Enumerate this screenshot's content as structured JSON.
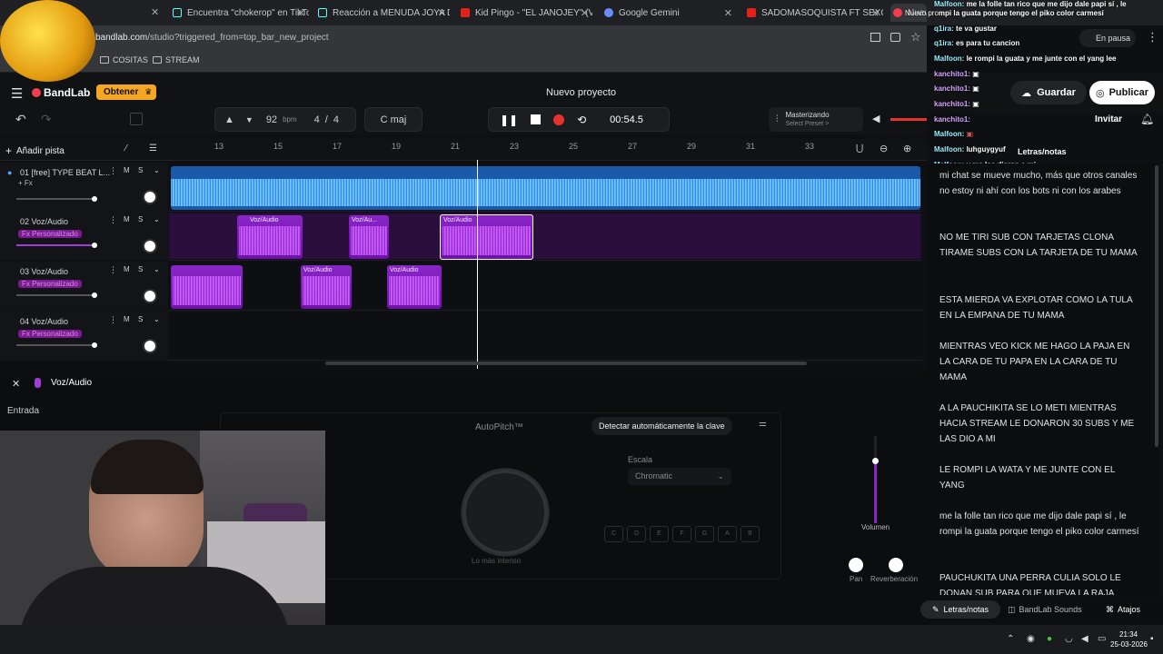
{
  "browser": {
    "tabs": [
      {
        "title": "Encuentra \"chokerop\" en TikTok"
      },
      {
        "title": "Reacción a MENUDA JOYA DYS"
      },
      {
        "title": "Kid Pingo - \"EL JANOJEY\" (VÍDE"
      },
      {
        "title": "Google Gemini"
      },
      {
        "title": "SADOMASOQUISTA FT SEXO //"
      },
      {
        "title": "Nuevo proyecto"
      }
    ],
    "url_domain": "bandlab.com",
    "url_path": "/studio?triggered_from=top_bar_new_project",
    "bookmarks": [
      "COSITAS",
      "STREAM"
    ],
    "paused_label": "En pausa"
  },
  "app": {
    "brand": "BandLab",
    "cta": "Obtener",
    "project_title": "Nuevo proyecto",
    "save": "Guardar",
    "publish": "Publicar",
    "invite": "Invitar",
    "add_track": "Añadir pista",
    "bpm": "92",
    "bpm_unit": "bpm",
    "time_sig_num": "4",
    "time_sig_den": "4",
    "key": "C maj",
    "time": "00:54.5",
    "mastering": "Masterizando",
    "mastering_sub": "Select Preset >"
  },
  "ruler": [
    "13",
    "15",
    "17",
    "19",
    "21",
    "23",
    "25",
    "27",
    "29",
    "31",
    "33"
  ],
  "tracks": [
    {
      "num": "01",
      "name": "[free] TYPE BEAT L...",
      "fx": "+ Fx"
    },
    {
      "num": "02",
      "name": "Voz/Audio",
      "fx": "Fx Personalizado"
    },
    {
      "num": "03",
      "name": "Voz/Audio",
      "fx": "Fx Personalizado"
    },
    {
      "num": "04",
      "name": "Voz/Audio",
      "fx": "Fx Personalizado"
    }
  ],
  "clip_label": "Voz/Audio",
  "clip_label_short": "Voz/Au...",
  "editor": {
    "title": "Voz/Audio",
    "input_label": "Entrada",
    "autopitch": "AutoPitch™",
    "detect_key": "Detectar automáticamente la clave",
    "scale_label": "Escala",
    "scale_value": "Chromatic",
    "intensity": "Lo más intenso",
    "volume": "Volumen",
    "pan": "Pan",
    "reverb": "Reverberación",
    "notes_keys": [
      "C",
      "D",
      "E",
      "F",
      "G",
      "A",
      "B"
    ]
  },
  "chat": [
    {
      "user": "Malfoon:",
      "msg": "me la folle tan rico que me dijo dale papi sí , le"
    },
    {
      "user": "Nuevo pro",
      "msg": "mpi la guata porque tengo el piko color carmesí"
    },
    {
      "user": "q1ira:",
      "msg": "te va gustar"
    },
    {
      "user": "q1ira:",
      "msg": "es para tu cancion"
    },
    {
      "user": "Malfoon:",
      "msg": "le rompi la guata y me junte con el yang lee"
    },
    {
      "user": "kanchito1:",
      "msg": ""
    },
    {
      "user": "kanchito1:",
      "msg": ""
    },
    {
      "user": "kanchito1:",
      "msg": ""
    },
    {
      "user": "kanchito1:",
      "msg": ""
    },
    {
      "user": "Malfoon:",
      "msg": ""
    },
    {
      "user": "Malfoon:",
      "msg": "luhguygyuf"
    },
    {
      "user": "Malfoon:",
      "msg": "y me las dieron a mi"
    }
  ],
  "notes_tab": "Letras/notas",
  "notes": [
    "mi chat se mueve mucho, más que otros canales no estoy ni ahí con los bots ni con los arabes",
    "NO ME TIRI SUB CON TARJETAS CLONA TIRAME SUBS CON LA TARJETA DE TU MAMA",
    "ESTA MIERDA VA EXPLOTAR COMO LA TULA EN LA EMPANA DE TU MAMA",
    "MIENTRAS VEO KICK ME HAGO LA PAJA EN LA CARA DE TU PAPA EN LA CARA DE TU MAMA",
    "A LA PAUCHIKITA SE LO METI MIENTRAS HACIA STREAM LE DONARON 30 SUBS Y ME LAS DIO A MI",
    "LE ROMPI LA WATA Y ME JUNTE CON EL YANG",
    "me la folle tan rico que me dijo dale papi sí , le rompi la guata porque tengo el piko color carmesí",
    "PAUCHUKITA UNA PERRA CULIA SOLO LE DONAN SUB PARA QUE MUEVA LA RAJA"
  ],
  "footer": {
    "lyrics": "Letras/notas",
    "sounds": "BandLab Sounds",
    "shortcuts": "Atajos"
  },
  "taskbar": {
    "time": "21:34",
    "date": "25-03-2026"
  },
  "colors": {
    "accent_purple": "#8a25c8",
    "beat_blue": "#2f8ee8",
    "record_red": "#e5322d",
    "brand_red": "#f23d4c",
    "cta_orange": "#f5a623"
  }
}
